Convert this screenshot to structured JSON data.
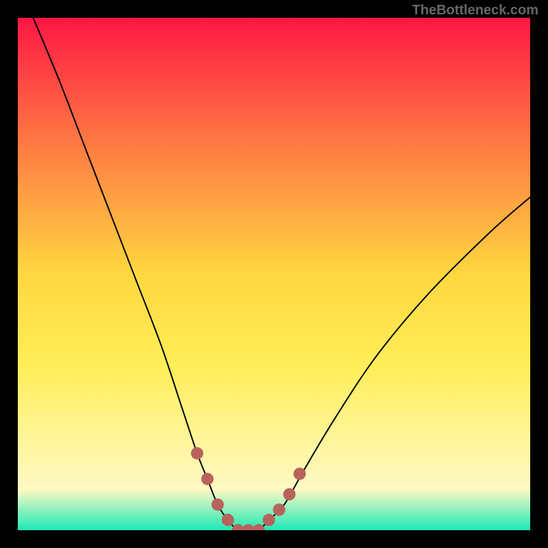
{
  "watermark": "TheBottleneck.com",
  "chart_data": {
    "type": "line",
    "title": "",
    "xlabel": "",
    "ylabel": "",
    "xlim": [
      0,
      100
    ],
    "ylim": [
      0,
      100
    ],
    "background_gradient": {
      "top": "#ff1744",
      "mid1": "#ff7043",
      "mid2": "#ffd740",
      "mid3": "#ffee58",
      "mid4": "#fff59d",
      "mid5": "#fff9c4",
      "bottom": "#1de9b6"
    },
    "series": [
      {
        "name": "bottleneck-curve",
        "x": [
          3,
          8,
          13,
          18,
          23,
          28,
          32,
          35,
          37,
          39,
          41,
          43,
          45,
          47,
          49,
          52,
          56,
          62,
          70,
          80,
          92,
          100
        ],
        "y": [
          100,
          88,
          75,
          62,
          49,
          36,
          24,
          15,
          10,
          5,
          2,
          0,
          0,
          0,
          2,
          5,
          12,
          22,
          34,
          46,
          58,
          65
        ]
      }
    ],
    "dotted_region": {
      "name": "curve-dotted-overlay",
      "color": "#b7635c",
      "points": [
        {
          "x": 35,
          "y": 15
        },
        {
          "x": 37,
          "y": 10
        },
        {
          "x": 39,
          "y": 5
        },
        {
          "x": 41,
          "y": 2
        },
        {
          "x": 43,
          "y": 0
        },
        {
          "x": 45,
          "y": 0
        },
        {
          "x": 47,
          "y": 0
        },
        {
          "x": 49,
          "y": 2
        },
        {
          "x": 51,
          "y": 4
        },
        {
          "x": 53,
          "y": 7
        },
        {
          "x": 55,
          "y": 11
        }
      ]
    },
    "frame_border_color": "#000000",
    "frame_border_width_px": 26
  }
}
